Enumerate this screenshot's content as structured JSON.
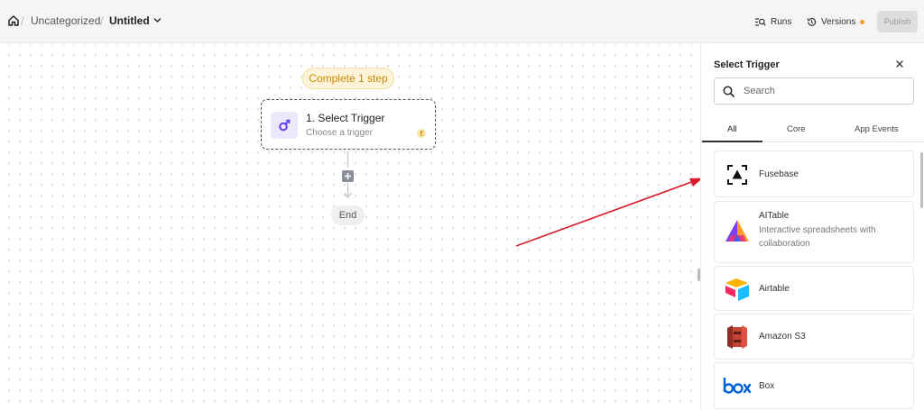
{
  "breadcrumb": {
    "separator": "/",
    "category": "Uncategorized",
    "title": "Untitled"
  },
  "header": {
    "runs_label": "Runs",
    "versions_label": "Versions",
    "publish_label": "Publish",
    "versions_dot_color": "#f0a030"
  },
  "canvas": {
    "status_pill": "Complete 1 step",
    "trigger": {
      "title": "1. Select Trigger",
      "subtitle": "Choose a trigger",
      "warning_glyph": "!"
    },
    "end_label": "End",
    "annotation_arrow_color": "#d61c2c"
  },
  "panel": {
    "title": "Select Trigger",
    "search_placeholder": "Search",
    "tabs": [
      {
        "label": "All",
        "active": true
      },
      {
        "label": "Core",
        "active": false
      },
      {
        "label": "App Events",
        "active": false
      }
    ],
    "apps": [
      {
        "name": "Fusebase",
        "icon": "fusebase-logo-icon"
      },
      {
        "name": "AITable",
        "description": "Interactive spreadsheets with collaboration",
        "icon": "aitable-logo-icon"
      },
      {
        "name": "Airtable",
        "icon": "airtable-logo-icon"
      },
      {
        "name": "Amazon S3",
        "icon": "amazon-s3-logo-icon"
      },
      {
        "name": "Box",
        "icon": "box-logo-icon"
      }
    ]
  },
  "colors": {
    "accent_purple": "#6a3df0",
    "pill_text": "#c98a06",
    "pill_background": "#fdf3d9"
  }
}
